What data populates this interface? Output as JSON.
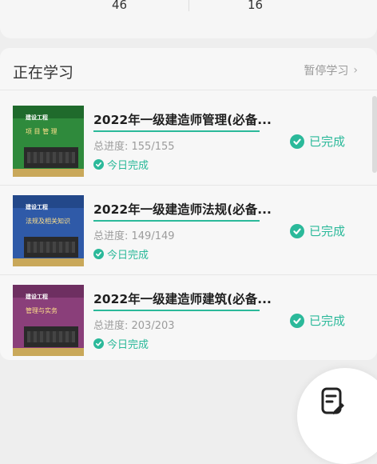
{
  "stats": {
    "left_value": "46",
    "right_value": "16"
  },
  "section": {
    "title": "正在学习",
    "pause_label": "暂停学习"
  },
  "courses": [
    {
      "title": "2022年一级建造师管理(必备...",
      "progress_text": "总进度: 155/155",
      "progress_ratio": 1.0,
      "today_label": "今日完成",
      "status_label": "已完成",
      "cover": {
        "brand": "建设工程",
        "subtitle": "项 目 管 理",
        "color": "#2f8a3c",
        "band_color": "#1f6a2c",
        "bottom_color": "#c9a85a"
      }
    },
    {
      "title": "2022年一级建造师法规(必备...",
      "progress_text": "总进度: 149/149",
      "progress_ratio": 1.0,
      "today_label": "今日完成",
      "status_label": "已完成",
      "cover": {
        "brand": "建设工程",
        "subtitle": "法规及相关知识",
        "color": "#2f5aa8",
        "band_color": "#23488a",
        "bottom_color": "#c9a85a"
      }
    },
    {
      "title": "2022年一级建造师建筑(必备...",
      "progress_text": "总进度: 203/203",
      "progress_ratio": 1.0,
      "today_label": "今日完成",
      "status_label": "已完成",
      "cover": {
        "brand": "建设工程",
        "subtitle": "管理与实务",
        "color": "#8a3f7a",
        "band_color": "#6e2f61",
        "bottom_color": "#c9a85a"
      }
    }
  ],
  "colors": {
    "accent": "#2bb99a",
    "background": "#eeeeee",
    "card": "#f7f7f7"
  },
  "icons": {
    "fab": "edit-note-icon",
    "check": "check-circle-icon",
    "chevron": "chevron-right-icon"
  }
}
